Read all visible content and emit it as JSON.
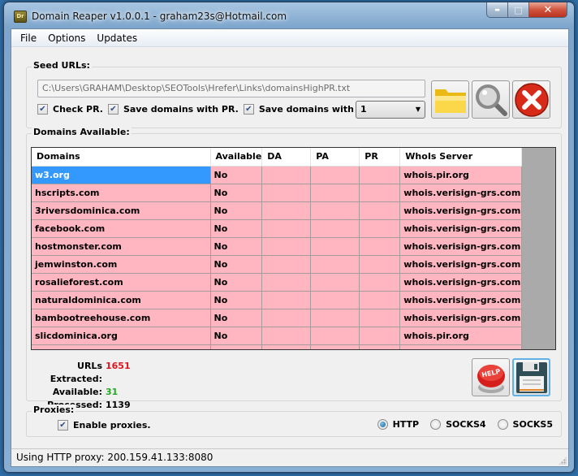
{
  "window": {
    "title": "Domain Reaper v1.0.0.1 - graham23s@Hotmail.com",
    "app_icon_text": "Dr",
    "minimize_glyph": "▬",
    "maximize_glyph": "□",
    "close_glyph": "✕"
  },
  "menu": [
    {
      "label": "File"
    },
    {
      "label": "Options"
    },
    {
      "label": "Updates"
    }
  ],
  "seed": {
    "group_label": "Seed URLs:",
    "path_value": "C:\\Users\\GRAHAM\\Desktop\\SEOTools\\Hrefer\\Links\\domainsHighPR.txt",
    "check_pr": {
      "label": "Check PR.",
      "checked": true
    },
    "save_pr": {
      "label": "Save domains with PR.",
      "checked": true
    },
    "save_da": {
      "label": "Save domains with DA >=",
      "checked": true
    },
    "da_select": "1",
    "buttons": {
      "open": "folder-icon",
      "search": "magnifier-icon",
      "stop": "stop-icon"
    }
  },
  "domains": {
    "group_label": "Domains Available:",
    "columns": [
      "Domains",
      "Available",
      "DA",
      "PA",
      "PR",
      "WhoIs Server"
    ],
    "rows": [
      {
        "domain": "w3.org",
        "available": "No",
        "da": "",
        "pa": "",
        "pr": "",
        "whois": "whois.pir.org"
      },
      {
        "domain": "hscripts.com",
        "available": "No",
        "da": "",
        "pa": "",
        "pr": "",
        "whois": "whois.verisign-grs.com"
      },
      {
        "domain": "3riversdominica.com",
        "available": "No",
        "da": "",
        "pa": "",
        "pr": "",
        "whois": "whois.verisign-grs.com"
      },
      {
        "domain": "facebook.com",
        "available": "No",
        "da": "",
        "pa": "",
        "pr": "",
        "whois": "whois.verisign-grs.com"
      },
      {
        "domain": "hostmonster.com",
        "available": "No",
        "da": "",
        "pa": "",
        "pr": "",
        "whois": "whois.verisign-grs.com"
      },
      {
        "domain": "jemwinston.com",
        "available": "No",
        "da": "",
        "pa": "",
        "pr": "",
        "whois": "whois.verisign-grs.com"
      },
      {
        "domain": "rosalieforest.com",
        "available": "No",
        "da": "",
        "pa": "",
        "pr": "",
        "whois": "whois.verisign-grs.com"
      },
      {
        "domain": "naturaldominica.com",
        "available": "No",
        "da": "",
        "pa": "",
        "pr": "",
        "whois": "whois.verisign-grs.com"
      },
      {
        "domain": "bambootreehouse.com",
        "available": "No",
        "da": "",
        "pa": "",
        "pr": "",
        "whois": "whois.verisign-grs.com"
      },
      {
        "domain": "slicdominica.org",
        "available": "No",
        "da": "",
        "pa": "",
        "pr": "",
        "whois": "whois.pir.org"
      }
    ],
    "selected_index": 0,
    "row_color": "#ffb6c1",
    "selected_color": "#3399ff"
  },
  "stats": {
    "extracted_label": "URLs Extracted:",
    "extracted_value": "1651",
    "available_label": "Available:",
    "available_value": "31",
    "processed_label": "Processed:",
    "processed_value": "1139",
    "help_text": "HELP"
  },
  "proxies": {
    "group_label": "Proxies:",
    "enable": {
      "label": "Enable proxies.",
      "checked": true
    },
    "types": [
      {
        "label": "HTTP",
        "selected": true
      },
      {
        "label": "SOCKS4",
        "selected": false
      },
      {
        "label": "SOCKS5",
        "selected": false
      }
    ]
  },
  "status": "Using HTTP proxy: 200.159.41.133:8080"
}
